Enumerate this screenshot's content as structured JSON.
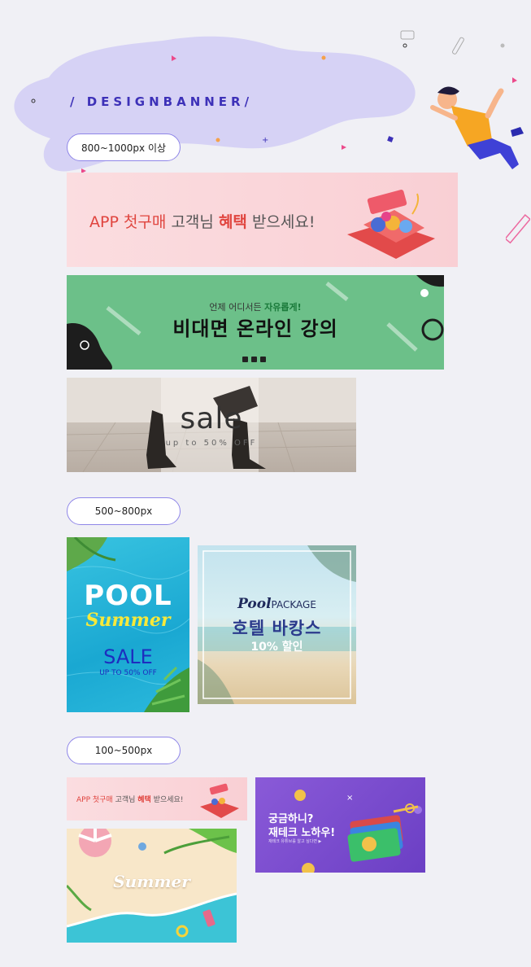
{
  "header": {
    "title": "/ DESIGNBANNER/"
  },
  "sections": [
    {
      "label": "800~1000px 이상"
    },
    {
      "label": "500~800px"
    },
    {
      "label": "100~500px"
    }
  ],
  "banners": {
    "app_large": {
      "part1": "APP 첫구매",
      "part2": " 고객님 ",
      "part3": "혜택",
      "part4": " 받으세요!"
    },
    "online": {
      "sub1": "언제 어디서든 ",
      "sub2": "자유롭게!",
      "main": "비대면 온라인 강의"
    },
    "sale": {
      "main": "sale",
      "sub": "up to 50% OFF"
    },
    "pool": {
      "pool": "POOL",
      "summer": "Summer",
      "sale": "SALE",
      "sub": "UP TO 50% OFF"
    },
    "hotel": {
      "pool": "Pool",
      "package": "PACKAGE",
      "main": "호텔 바캉스",
      "discount": "10% 할인"
    },
    "app_small": {
      "part1": "APP 첫구매",
      "part2": " 고객님 ",
      "part3": "혜택",
      "part4": " 받으세요!"
    },
    "money": {
      "line1": "궁금하니?",
      "line2": "재테크 노하우!",
      "small": "재테크 유튜브를 알고 싶다면 ▶"
    },
    "summer": {
      "word": "Summer"
    }
  },
  "colors": {
    "accent": "#3d31b8",
    "pill_border": "#8f86e8",
    "blob": "#d6d2f5",
    "pink_banner": "#fbd9dc",
    "green_banner": "#6cc089",
    "pool_bg": "#2cb8d8",
    "purple_banner": "#7b4fd0"
  }
}
